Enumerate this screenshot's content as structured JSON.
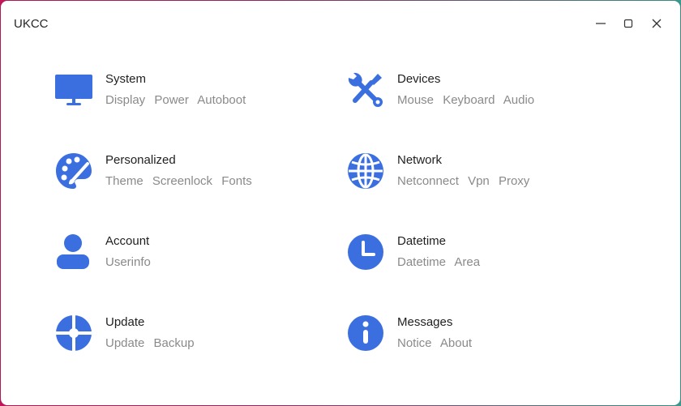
{
  "window": {
    "title": "UKCC"
  },
  "accent": "#3b6fe0",
  "categories": [
    {
      "name": "System",
      "icon": "monitor-icon",
      "items": [
        "Display",
        "Power",
        "Autoboot"
      ]
    },
    {
      "name": "Devices",
      "icon": "tools-icon",
      "items": [
        "Mouse",
        "Keyboard",
        "Audio"
      ]
    },
    {
      "name": "Personalized",
      "icon": "palette-icon",
      "items": [
        "Theme",
        "Screenlock",
        "Fonts"
      ]
    },
    {
      "name": "Network",
      "icon": "globe-icon",
      "items": [
        "Netconnect",
        "Vpn",
        "Proxy"
      ]
    },
    {
      "name": "Account",
      "icon": "user-icon",
      "items": [
        "Userinfo"
      ]
    },
    {
      "name": "Datetime",
      "icon": "clock-icon",
      "items": [
        "Datetime",
        "Area"
      ]
    },
    {
      "name": "Update",
      "icon": "update-icon",
      "items": [
        "Update",
        "Backup"
      ]
    },
    {
      "name": "Messages",
      "icon": "info-icon",
      "items": [
        "Notice",
        "About"
      ]
    }
  ]
}
